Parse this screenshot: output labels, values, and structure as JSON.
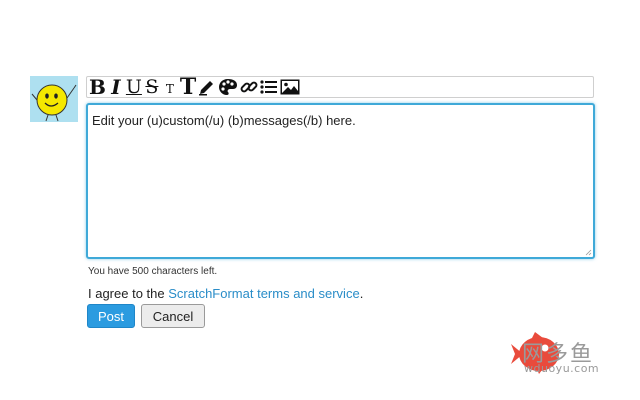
{
  "avatar": {
    "icon": "smiley-face-icon",
    "bg_color": "#aee0f0"
  },
  "toolbar": {
    "bold": "B",
    "italic": "I",
    "underline": "U",
    "strike": "S",
    "small": "T",
    "big": "T",
    "icons": [
      "pencil-icon",
      "palette-icon",
      "link-icon",
      "list-icon",
      "image-icon"
    ]
  },
  "editor": {
    "value": "Edit your (u)custom(/u) (b)messages(/b) here.",
    "border_color": "#3fa9d8"
  },
  "status": {
    "chars_left": "You have 500 characters left."
  },
  "agreement": {
    "prefix": "I agree to the ",
    "link": "ScratchFormat terms and service",
    "suffix": "."
  },
  "buttons": {
    "post": "Post",
    "cancel": "Cancel",
    "post_color": "#2b9be0"
  },
  "watermark": {
    "chinese": "网多鱼",
    "domain": "wduoyu.com",
    "color": "#e94b3c"
  }
}
